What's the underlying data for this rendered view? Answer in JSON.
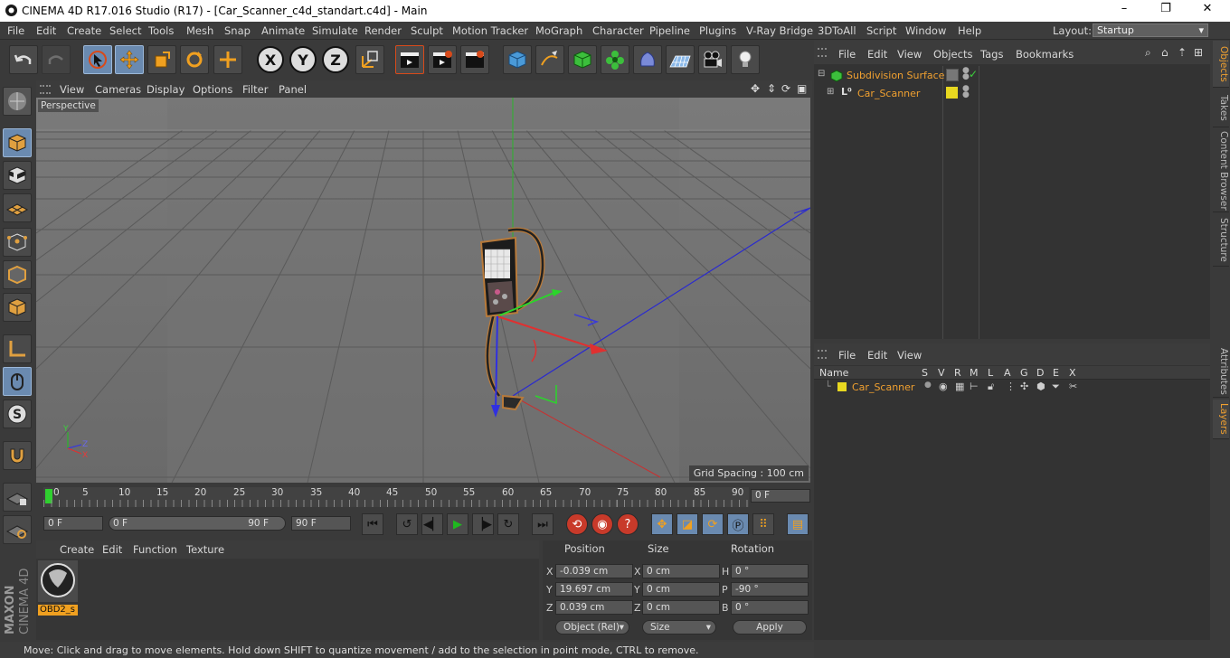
{
  "window": {
    "title": "CINEMA 4D R17.016 Studio (R17) - [Car_Scanner_c4d_standart.c4d] - Main",
    "minimize": "–",
    "maximize": "❐",
    "close": "✕"
  },
  "menu": [
    "File",
    "Edit",
    "Create",
    "Select",
    "Tools",
    "Mesh",
    "Snap",
    "Animate",
    "Simulate",
    "Render",
    "Sculpt",
    "Motion Tracker",
    "MoGraph",
    "Character",
    "Pipeline",
    "Plugins",
    "V-Ray Bridge",
    "3DToAll",
    "Script",
    "Window",
    "Help"
  ],
  "layout": {
    "label": "Layout:",
    "value": "Startup"
  },
  "toolbar": {
    "axis_x": "X",
    "axis_y": "Y",
    "axis_z": "Z"
  },
  "viewport": {
    "menu": [
      "View",
      "Cameras",
      "Display",
      "Options",
      "Filter",
      "Panel"
    ],
    "label": "Perspective",
    "grid_spacing": "Grid Spacing : 100 cm",
    "axis_y": "Y",
    "axis_z": "Z",
    "axis_x": "X"
  },
  "timeline": {
    "ticks": [
      "0",
      "5",
      "10",
      "15",
      "20",
      "25",
      "30",
      "35",
      "40",
      "45",
      "50",
      "55",
      "60",
      "65",
      "70",
      "75",
      "80",
      "85",
      "90"
    ],
    "frame": "0 F"
  },
  "anim": {
    "start": "0 F",
    "range_start": "0 F",
    "range_end": "90 F",
    "end": "90 F"
  },
  "material": {
    "menu": [
      "Create",
      "Edit",
      "Function",
      "Texture"
    ],
    "swatch_label": "OBD2_s"
  },
  "coords": {
    "headers": {
      "position": "Position",
      "size": "Size",
      "rotation": "Rotation"
    },
    "rows": [
      {
        "axis": "X",
        "pos": "-0.039 cm",
        "saxis": "X",
        "size": "0 cm",
        "raxis": "H",
        "rot": "0 °"
      },
      {
        "axis": "Y",
        "pos": "19.697 cm",
        "saxis": "Y",
        "size": "0 cm",
        "raxis": "P",
        "rot": "-90 °"
      },
      {
        "axis": "Z",
        "pos": "0.039 cm",
        "saxis": "Z",
        "size": "0 cm",
        "raxis": "B",
        "rot": "0 °"
      }
    ],
    "mode": "Object (Rel)",
    "size_mode": "Size",
    "apply": "Apply"
  },
  "status": "Move: Click and drag to move elements. Hold down SHIFT to quantize movement / add to the selection in point mode, CTRL to remove.",
  "objects": {
    "menu": [
      "File",
      "Edit",
      "View",
      "Objects",
      "Tags",
      "Bookmarks"
    ],
    "items": [
      {
        "name": "Subdivision Surface"
      },
      {
        "name": "Car_Scanner"
      }
    ]
  },
  "layers": {
    "menu": [
      "File",
      "Edit",
      "View"
    ],
    "columns": [
      "Name",
      "S",
      "V",
      "R",
      "M",
      "L",
      "A",
      "G",
      "D",
      "E",
      "X"
    ],
    "items": [
      {
        "name": "Car_Scanner"
      }
    ]
  },
  "side_tabs": [
    "Objects",
    "Takes",
    "Content Browser",
    "Structure",
    "Attributes",
    "Layers"
  ],
  "brand": {
    "maxon": "MAXON",
    "product": "CINEMA 4D"
  },
  "colors": {
    "accent": "#f0a030",
    "layer_yellow": "#e8d820",
    "selected_tool": "#6a8ab0"
  }
}
